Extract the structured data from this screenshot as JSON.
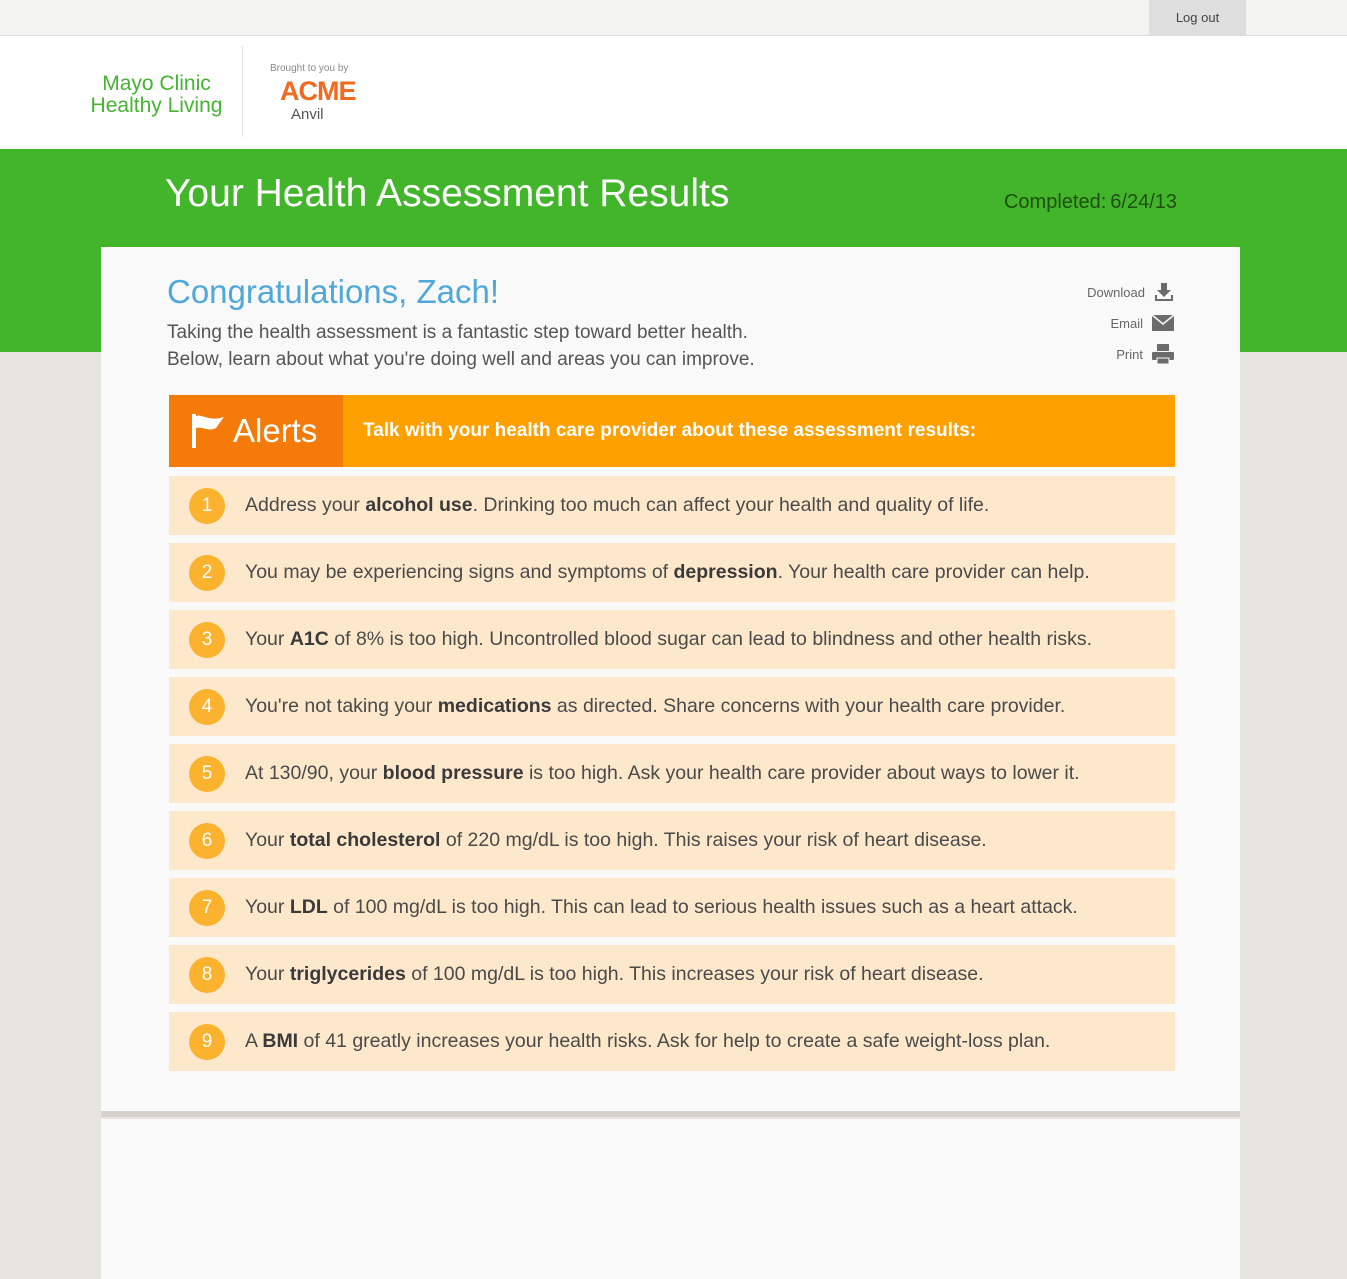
{
  "topbar": {
    "logout_label": "Log out"
  },
  "header": {
    "brand_line1": "Mayo Clinic",
    "brand_line2": "Healthy Living",
    "sponsor_pre": "Brought to you by",
    "sponsor_name": "ACME",
    "sponsor_sub": "Anvil"
  },
  "banner": {
    "title": "Your Health Assessment Results",
    "completed_label": "Completed:",
    "completed_date": "6/24/13"
  },
  "card": {
    "greeting": "Congratulations, Zach!",
    "intro_line1": "Taking the health assessment is a fantastic step toward better health.",
    "intro_line2": "Below, learn about what you're doing well and areas you can improve.",
    "actions": {
      "download": "Download",
      "email": "Email",
      "print": "Print"
    }
  },
  "alerts": {
    "tag_label": "Alerts",
    "message": "Talk with your health care provider about these assessment results:",
    "items": [
      {
        "num": "1",
        "pre": "Address your ",
        "bold": "alcohol use",
        "post": ". Drinking too much can affect your health and quality of life."
      },
      {
        "num": "2",
        "pre": "You may be experiencing signs and symptoms of ",
        "bold": "depression",
        "post": ". Your health care provider can help."
      },
      {
        "num": "3",
        "pre": "Your ",
        "bold": "A1C",
        "post": " of 8% is too high. Uncontrolled blood sugar can lead to blindness and other health risks."
      },
      {
        "num": "4",
        "pre": "You're not taking your ",
        "bold": "medications",
        "post": " as directed. Share concerns with your health care provider."
      },
      {
        "num": "5",
        "pre": "At 130/90, your ",
        "bold": "blood pressure",
        "post": " is too high. Ask your health care provider about ways to lower it."
      },
      {
        "num": "6",
        "pre": "Your ",
        "bold": "total cholesterol",
        "post": " of 220 mg/dL is too high. This raises your risk of heart disease."
      },
      {
        "num": "7",
        "pre": "Your ",
        "bold": "LDL",
        "post": " of 100 mg/dL is too high. This can lead to serious health issues such as a heart attack."
      },
      {
        "num": "8",
        "pre": "Your ",
        "bold": "triglycerides",
        "post": " of 100 mg/dL is too high. This increases your risk of heart disease."
      },
      {
        "num": "9",
        "pre": "A ",
        "bold": "BMI",
        "post": " of 41 greatly increases your health risks. Ask for help to create a safe weight-loss plan."
      }
    ]
  },
  "colors": {
    "brand_green": "#43b52b",
    "alert_orange": "#fea100",
    "alert_tag_orange": "#f47b0a",
    "item_bg": "#fde8cc",
    "number_badge": "#fbb22e",
    "greeting_blue": "#4fa8d9",
    "sponsor_orange": "#f06a21"
  },
  "icons": {
    "download": "download-icon",
    "email": "envelope-icon",
    "print": "printer-icon",
    "alerts": "flag-icon"
  }
}
